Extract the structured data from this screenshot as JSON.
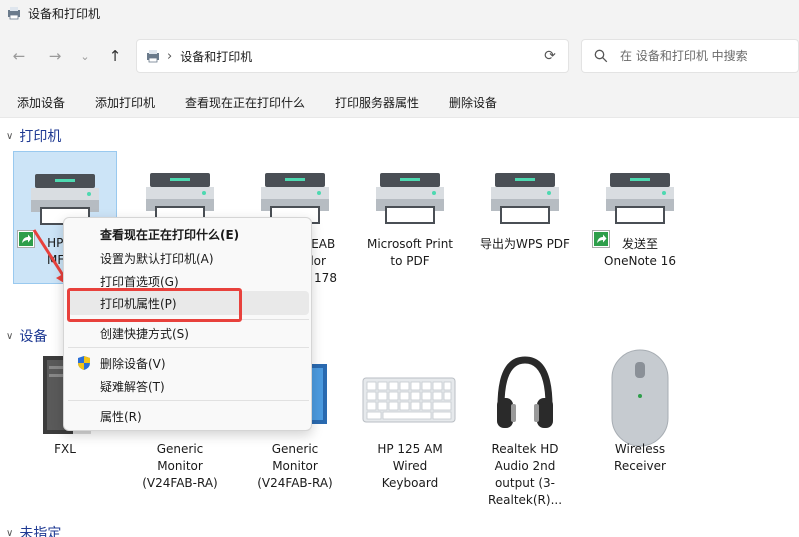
{
  "window": {
    "title": "设备和打印机"
  },
  "nav": {
    "back_icon": "arrow-left-icon",
    "forward_icon": "arrow-right-icon",
    "recent_icon": "chevron-down-icon",
    "up_icon": "arrow-up-icon"
  },
  "address": {
    "path": "设备和打印机",
    "refresh_icon": "refresh-icon"
  },
  "search": {
    "placeholder": "在 设备和打印机 中搜索"
  },
  "commands": [
    "添加设备",
    "添加打印机",
    "查看现在正在打印什么",
    "打印服务器属性",
    "删除设备"
  ],
  "groups": {
    "printers": {
      "label": "打印机"
    },
    "devices": {
      "label": "设备"
    },
    "unspecified": {
      "label": "未指定"
    }
  },
  "printers": [
    {
      "line1": "HP Co",
      "line2": "MFP 1"
    },
    {
      "line1": "",
      "line2": ""
    },
    {
      "line1": "AEAB",
      "line2": "olor",
      "line3": "P 178"
    },
    {
      "line1": "Microsoft Print",
      "line2": "to PDF"
    },
    {
      "line1": "导出为WPS PDF",
      "line2": ""
    },
    {
      "line1": "发送至",
      "line2": "OneNote 16"
    }
  ],
  "devices": [
    {
      "line1": "FXL"
    },
    {
      "line1": "Generic",
      "line2": "Monitor",
      "line3": "(V24FAB-RA)"
    },
    {
      "line1": "Generic",
      "line2": "Monitor",
      "line3": "(V24FAB-RA)"
    },
    {
      "line1": "HP 125 AM",
      "line2": "Wired",
      "line3": "Keyboard"
    },
    {
      "line1": "Realtek HD",
      "line2": "Audio 2nd",
      "line3": "output (3-",
      "line4": "Realtek(R)..."
    },
    {
      "line1": "Wireless",
      "line2": "Receiver"
    }
  ],
  "context_menu": {
    "items": [
      {
        "label": "查看现在正在打印什么(E)"
      },
      {
        "label": "设置为默认打印机(A)"
      },
      {
        "label": "打印首选项(G)"
      },
      {
        "label": "打印机属性(P)"
      },
      {
        "label": "创建快捷方式(S)"
      },
      {
        "label": "删除设备(V)"
      },
      {
        "label": "疑难解答(T)"
      },
      {
        "label": "属性(R)"
      }
    ]
  },
  "colors": {
    "accent": "#1f3a93",
    "highlight": "#e8413c",
    "selection": "#cce4f7"
  }
}
